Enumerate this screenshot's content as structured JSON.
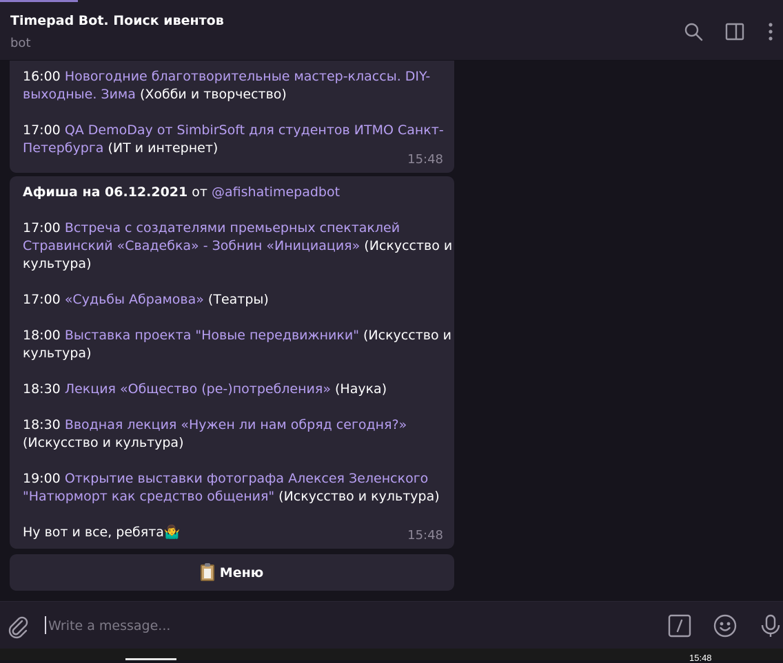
{
  "header": {
    "title": "Timepad Bot. Поиск ивентов",
    "status": "bot"
  },
  "messages": [
    {
      "lines": [
        {
          "time": "16:00",
          "link": "Новогодние благотворительные мастер-классы. DIY-",
          "text": ""
        },
        {
          "time": "",
          "link": "выходные. Зима",
          "text": " (Хобби и творчество)"
        },
        {
          "gap": true
        },
        {
          "time": "17:00",
          "link": "QA DemoDay от SimbirSoft для студентов ИТМО Санкт-",
          "text": ""
        },
        {
          "time": "",
          "link": "Петербурга",
          "text": " (ИТ и интернет)"
        }
      ],
      "timestamp": "15:48"
    },
    {
      "heading": {
        "bold": "Афиша на 06.12.2021",
        "from": " от ",
        "mention": "@afishatimepadbot"
      },
      "lines": [
        {
          "gap": true
        },
        {
          "time": "17:00",
          "link": "Встреча с создателями премьерных спектаклей",
          "text": ""
        },
        {
          "time": "",
          "link": "Стравинский «Свадебка» - Зобнин «Инициация»",
          "text": " (Искусство и"
        },
        {
          "time": "",
          "link": "",
          "text": "культура)"
        },
        {
          "gap": true
        },
        {
          "time": "17:00",
          "link": "«Судьбы Абрамова»",
          "text": " (Театры)"
        },
        {
          "gap": true
        },
        {
          "time": "18:00",
          "link": "Выставка проекта \"Новые передвижники\"",
          "text": " (Искусство и"
        },
        {
          "time": "",
          "link": "",
          "text": "культура)"
        },
        {
          "gap": true
        },
        {
          "time": "18:30",
          "link": "Лекция «Общество (ре-)потребления»",
          "text": " (Наука)"
        },
        {
          "gap": true
        },
        {
          "time": "18:30",
          "link": "Вводная лекция «Нужен ли нам обряд сегодня?»",
          "text": ""
        },
        {
          "time": "",
          "link": "",
          "text": "(Искусство и культура)"
        },
        {
          "gap": true
        },
        {
          "time": "19:00",
          "link": "Открытие выставки фотографа Алексея Зеленского",
          "text": ""
        },
        {
          "time": "",
          "link": "\"Натюрморт как средство общения\"",
          "text": " (Искусство и культура)"
        },
        {
          "gap": true
        },
        {
          "time": "",
          "link": "",
          "text": "Ну вот и все, ребята🤷‍♂️"
        }
      ],
      "timestamp": "15:48"
    }
  ],
  "keyboard": {
    "menu_label": "Меню",
    "menu_icon": "clipboard-emoji"
  },
  "composer": {
    "placeholder": "Write a message..."
  },
  "taskbar": {
    "clock": "15:48"
  },
  "icons": {
    "search": "search-icon",
    "sidebar": "sidebar-toggle-icon",
    "more": "more-vertical-icon",
    "attach": "paperclip-icon",
    "commands": "slash-command-icon",
    "emoji": "smile-icon",
    "voice": "microphone-icon"
  },
  "colors": {
    "link": "#b79ff2",
    "bubble": "#2a2634",
    "background": "#16141c",
    "header": "#211d29"
  }
}
